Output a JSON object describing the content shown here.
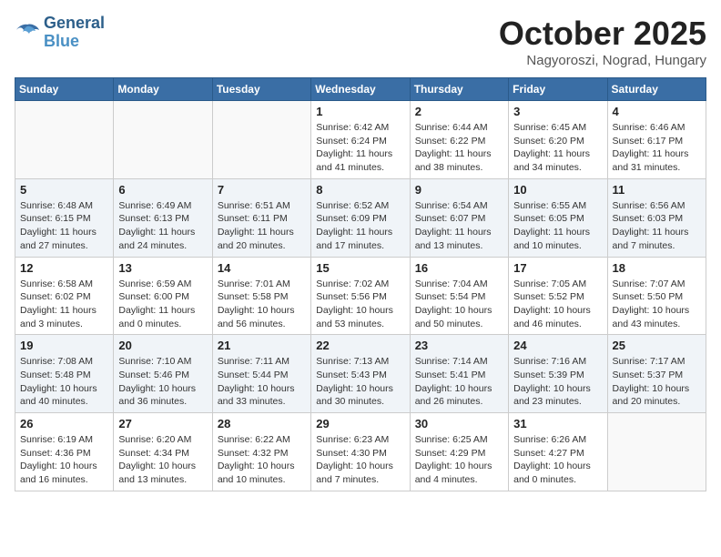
{
  "header": {
    "logo_line1": "General",
    "logo_line2": "Blue",
    "month": "October 2025",
    "location": "Nagyoroszi, Nograd, Hungary"
  },
  "weekdays": [
    "Sunday",
    "Monday",
    "Tuesday",
    "Wednesday",
    "Thursday",
    "Friday",
    "Saturday"
  ],
  "weeks": [
    [
      {
        "day": "",
        "info": ""
      },
      {
        "day": "",
        "info": ""
      },
      {
        "day": "",
        "info": ""
      },
      {
        "day": "1",
        "info": "Sunrise: 6:42 AM\nSunset: 6:24 PM\nDaylight: 11 hours and 41 minutes."
      },
      {
        "day": "2",
        "info": "Sunrise: 6:44 AM\nSunset: 6:22 PM\nDaylight: 11 hours and 38 minutes."
      },
      {
        "day": "3",
        "info": "Sunrise: 6:45 AM\nSunset: 6:20 PM\nDaylight: 11 hours and 34 minutes."
      },
      {
        "day": "4",
        "info": "Sunrise: 6:46 AM\nSunset: 6:17 PM\nDaylight: 11 hours and 31 minutes."
      }
    ],
    [
      {
        "day": "5",
        "info": "Sunrise: 6:48 AM\nSunset: 6:15 PM\nDaylight: 11 hours and 27 minutes."
      },
      {
        "day": "6",
        "info": "Sunrise: 6:49 AM\nSunset: 6:13 PM\nDaylight: 11 hours and 24 minutes."
      },
      {
        "day": "7",
        "info": "Sunrise: 6:51 AM\nSunset: 6:11 PM\nDaylight: 11 hours and 20 minutes."
      },
      {
        "day": "8",
        "info": "Sunrise: 6:52 AM\nSunset: 6:09 PM\nDaylight: 11 hours and 17 minutes."
      },
      {
        "day": "9",
        "info": "Sunrise: 6:54 AM\nSunset: 6:07 PM\nDaylight: 11 hours and 13 minutes."
      },
      {
        "day": "10",
        "info": "Sunrise: 6:55 AM\nSunset: 6:05 PM\nDaylight: 11 hours and 10 minutes."
      },
      {
        "day": "11",
        "info": "Sunrise: 6:56 AM\nSunset: 6:03 PM\nDaylight: 11 hours and 7 minutes."
      }
    ],
    [
      {
        "day": "12",
        "info": "Sunrise: 6:58 AM\nSunset: 6:02 PM\nDaylight: 11 hours and 3 minutes."
      },
      {
        "day": "13",
        "info": "Sunrise: 6:59 AM\nSunset: 6:00 PM\nDaylight: 11 hours and 0 minutes."
      },
      {
        "day": "14",
        "info": "Sunrise: 7:01 AM\nSunset: 5:58 PM\nDaylight: 10 hours and 56 minutes."
      },
      {
        "day": "15",
        "info": "Sunrise: 7:02 AM\nSunset: 5:56 PM\nDaylight: 10 hours and 53 minutes."
      },
      {
        "day": "16",
        "info": "Sunrise: 7:04 AM\nSunset: 5:54 PM\nDaylight: 10 hours and 50 minutes."
      },
      {
        "day": "17",
        "info": "Sunrise: 7:05 AM\nSunset: 5:52 PM\nDaylight: 10 hours and 46 minutes."
      },
      {
        "day": "18",
        "info": "Sunrise: 7:07 AM\nSunset: 5:50 PM\nDaylight: 10 hours and 43 minutes."
      }
    ],
    [
      {
        "day": "19",
        "info": "Sunrise: 7:08 AM\nSunset: 5:48 PM\nDaylight: 10 hours and 40 minutes."
      },
      {
        "day": "20",
        "info": "Sunrise: 7:10 AM\nSunset: 5:46 PM\nDaylight: 10 hours and 36 minutes."
      },
      {
        "day": "21",
        "info": "Sunrise: 7:11 AM\nSunset: 5:44 PM\nDaylight: 10 hours and 33 minutes."
      },
      {
        "day": "22",
        "info": "Sunrise: 7:13 AM\nSunset: 5:43 PM\nDaylight: 10 hours and 30 minutes."
      },
      {
        "day": "23",
        "info": "Sunrise: 7:14 AM\nSunset: 5:41 PM\nDaylight: 10 hours and 26 minutes."
      },
      {
        "day": "24",
        "info": "Sunrise: 7:16 AM\nSunset: 5:39 PM\nDaylight: 10 hours and 23 minutes."
      },
      {
        "day": "25",
        "info": "Sunrise: 7:17 AM\nSunset: 5:37 PM\nDaylight: 10 hours and 20 minutes."
      }
    ],
    [
      {
        "day": "26",
        "info": "Sunrise: 6:19 AM\nSunset: 4:36 PM\nDaylight: 10 hours and 16 minutes."
      },
      {
        "day": "27",
        "info": "Sunrise: 6:20 AM\nSunset: 4:34 PM\nDaylight: 10 hours and 13 minutes."
      },
      {
        "day": "28",
        "info": "Sunrise: 6:22 AM\nSunset: 4:32 PM\nDaylight: 10 hours and 10 minutes."
      },
      {
        "day": "29",
        "info": "Sunrise: 6:23 AM\nSunset: 4:30 PM\nDaylight: 10 hours and 7 minutes."
      },
      {
        "day": "30",
        "info": "Sunrise: 6:25 AM\nSunset: 4:29 PM\nDaylight: 10 hours and 4 minutes."
      },
      {
        "day": "31",
        "info": "Sunrise: 6:26 AM\nSunset: 4:27 PM\nDaylight: 10 hours and 0 minutes."
      },
      {
        "day": "",
        "info": ""
      }
    ]
  ]
}
